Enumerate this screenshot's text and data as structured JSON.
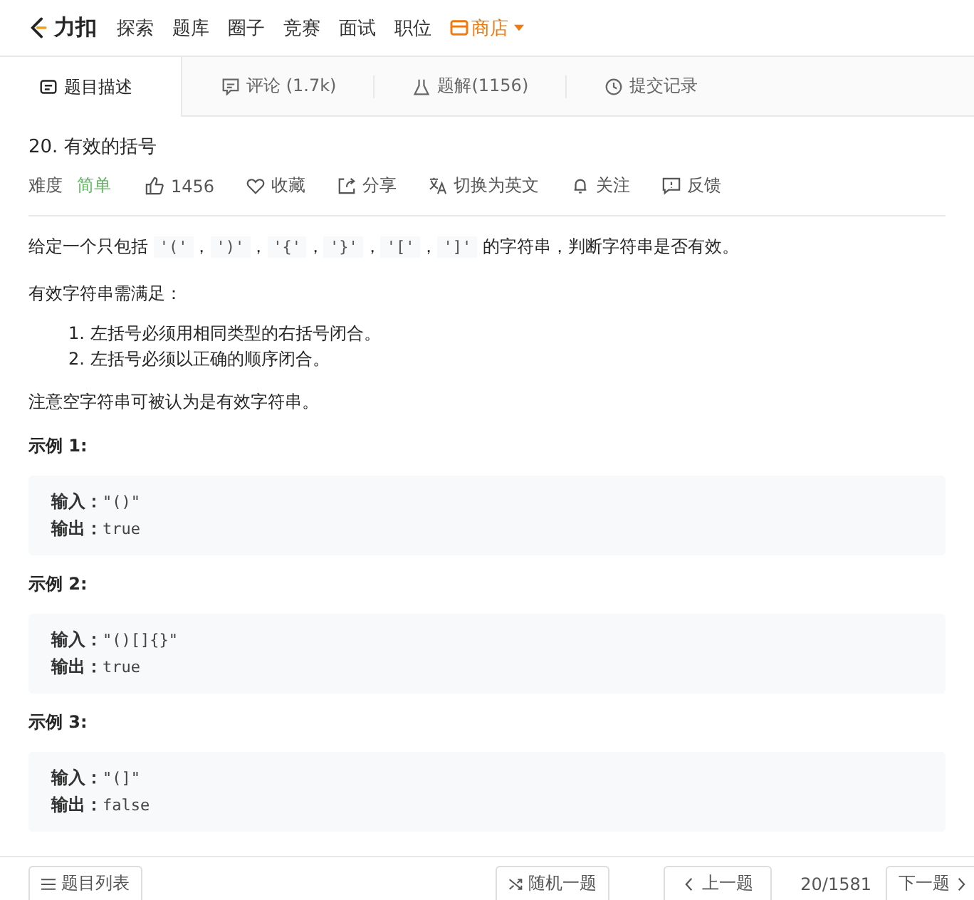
{
  "header": {
    "logo": "力扣",
    "nav": [
      {
        "label": "探索",
        "kind": "link"
      },
      {
        "label": "题库",
        "kind": "link"
      },
      {
        "label": "圈子",
        "kind": "link"
      },
      {
        "label": "竞赛",
        "kind": "link"
      },
      {
        "label": "面试",
        "kind": "link"
      },
      {
        "label": "职位",
        "kind": "link"
      },
      {
        "label": "商店",
        "kind": "store"
      }
    ]
  },
  "tabs": [
    {
      "label": "题目描述",
      "kind": "description",
      "selected": true
    },
    {
      "label": "评论 (1.7k)",
      "kind": "comments",
      "selected": false
    },
    {
      "label": "题解(1156)",
      "kind": "solutions",
      "selected": false
    },
    {
      "label": "提交记录",
      "kind": "submissions",
      "selected": false
    }
  ],
  "problem": {
    "title": "20. 有效的括号",
    "difficulty_label": "难度",
    "difficulty": "简单",
    "actions": [
      {
        "kind": "like",
        "label": "1456"
      },
      {
        "kind": "favorite",
        "label": "收藏"
      },
      {
        "kind": "share",
        "label": "分享"
      },
      {
        "kind": "translate",
        "label": "切换为英文"
      },
      {
        "kind": "follow",
        "label": "关注"
      },
      {
        "kind": "feedback",
        "label": "反馈"
      }
    ],
    "intro": [
      {
        "kind": "text",
        "text": "给定一个只包括 "
      },
      {
        "kind": "code",
        "text": "'('"
      },
      {
        "kind": "text",
        "text": "，"
      },
      {
        "kind": "code",
        "text": "')'"
      },
      {
        "kind": "text",
        "text": "，"
      },
      {
        "kind": "code",
        "text": "'{'"
      },
      {
        "kind": "text",
        "text": "，"
      },
      {
        "kind": "code",
        "text": "'}'"
      },
      {
        "kind": "text",
        "text": "，"
      },
      {
        "kind": "code",
        "text": "'['"
      },
      {
        "kind": "text",
        "text": "，"
      },
      {
        "kind": "code",
        "text": "']'"
      },
      {
        "kind": "text",
        "text": " 的字符串，判断字符串是否有效。"
      }
    ],
    "rules_intro": "有效字符串需满足：",
    "rules": [
      {
        "number": "1.",
        "text": "左括号必须用相同类型的右括号闭合。"
      },
      {
        "number": "2.",
        "text": "左括号必须以正确的顺序闭合。"
      }
    ],
    "note": "注意空字符串可被认为是有效字符串。",
    "examples": [
      {
        "title": "示例 1:",
        "input_label": "输入：",
        "input": "\"()\"",
        "output_label": "输出：",
        "output": "true"
      },
      {
        "title": "示例 2:",
        "input_label": "输入：",
        "input": "\"()[]{}\"",
        "output_label": "输出：",
        "output": "true"
      },
      {
        "title": "示例 3:",
        "input_label": "输入：",
        "input": "\"(]\"",
        "output_label": "输出：",
        "output": "false"
      }
    ]
  },
  "footer": {
    "list": "题目列表",
    "random": "随机一题",
    "prev": "上一题",
    "position": "20/1581",
    "next": "下一题"
  }
}
